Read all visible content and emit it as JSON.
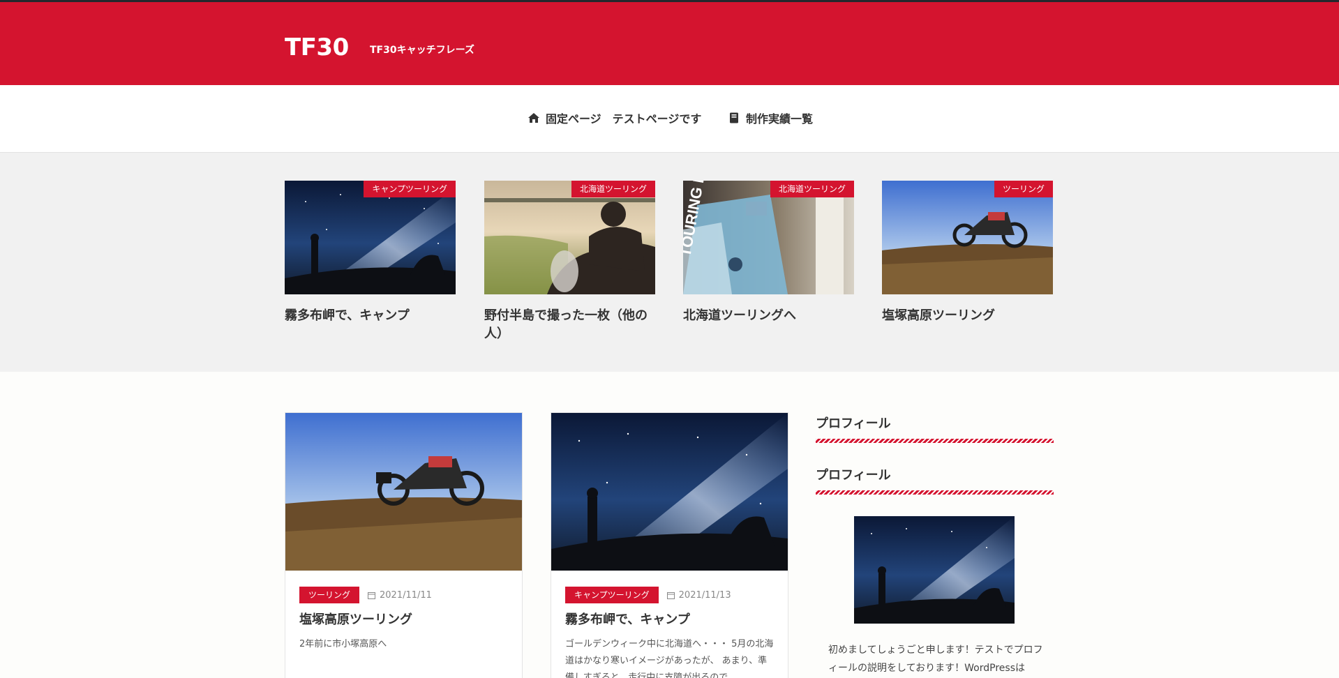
{
  "site": {
    "title": "TF30",
    "tagline": "TF30キャッチフレーズ"
  },
  "nav": {
    "items": [
      {
        "label": "固定ページ　テストページです",
        "icon": "home-icon"
      },
      {
        "label": "制作実績一覧",
        "icon": "book-icon"
      }
    ]
  },
  "pickup": [
    {
      "category": "キャンプツーリング",
      "title": "霧多布岬で、キャンプ",
      "image": "milky-way-rider"
    },
    {
      "category": "北海道ツーリング",
      "title": "野付半島で撮った一枚（他の人）",
      "image": "sunset-rider"
    },
    {
      "category": "北海道ツーリング",
      "title": "北海道ツーリングへ",
      "image": "touring-map-book"
    },
    {
      "category": "ツーリング",
      "title": "塩塚高原ツーリング",
      "image": "motorcycle-sunset"
    }
  ],
  "posts": [
    {
      "category": "ツーリング",
      "date": "2021/11/11",
      "title": "塩塚高原ツーリング",
      "excerpt": "2年前に市小塚高原へ"
    },
    {
      "category": "キャンプツーリング",
      "date": "2021/11/13",
      "title": "霧多布岬で、キャンプ",
      "excerpt": "ゴールデンウィーク中に北海道へ・・・ 5月の北海道はかなり寒いイメージがあったが、 あまり、準備しすぎると、走行中に支障が出るので"
    }
  ],
  "sidebar": {
    "widget1_title": "プロフィール",
    "widget2_title": "プロフィール",
    "profile_text": "初めましてしょうごと申します！テストでプロフィールの説明をしております！WordPressは"
  },
  "colors": {
    "brand": "#d4142f",
    "header_bar": "#23282d",
    "pickup_bg": "#f1f1f1"
  }
}
